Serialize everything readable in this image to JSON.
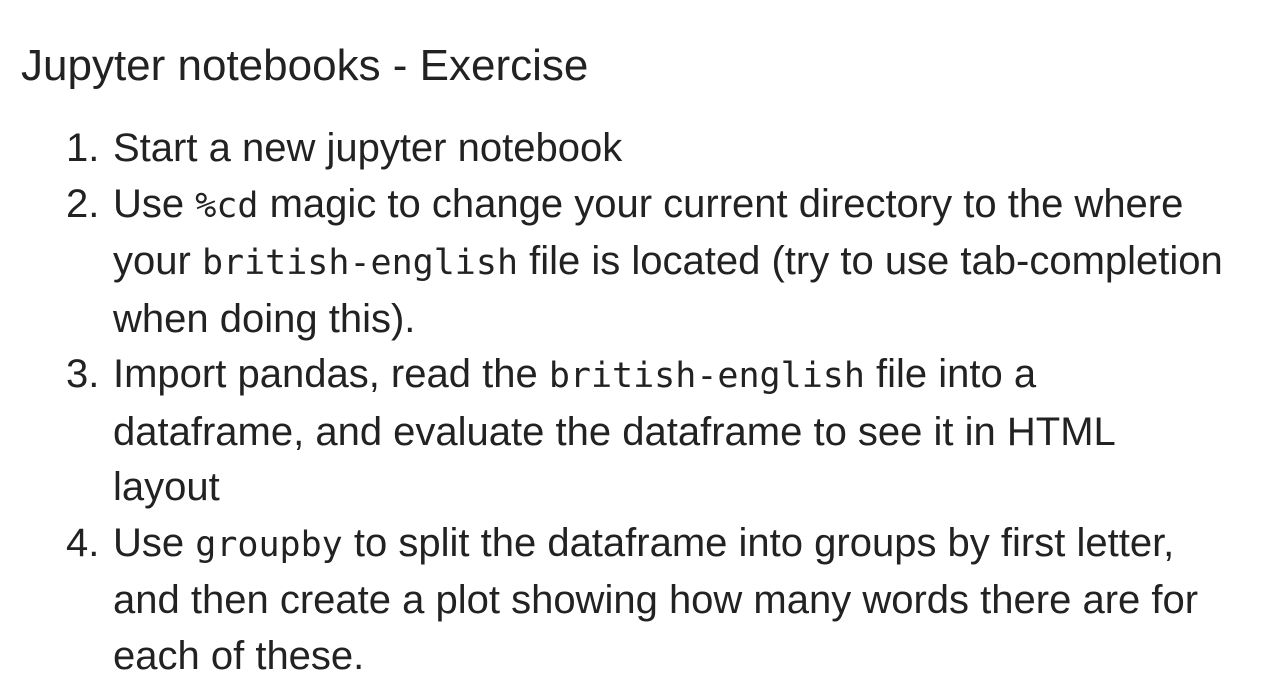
{
  "slide": {
    "title": "Jupyter notebooks - Exercise",
    "steps": [
      {
        "number": "1.",
        "parts": [
          {
            "text": "Start a new jupyter notebook",
            "code": false
          }
        ]
      },
      {
        "number": "2.",
        "parts": [
          {
            "text": "Use ",
            "code": false
          },
          {
            "text": "%cd",
            "code": true
          },
          {
            "text": " magic to change your current directory to the where your ",
            "code": false
          },
          {
            "text": "british-english",
            "code": true
          },
          {
            "text": " file is located (try to use tab-completion when doing this).",
            "code": false
          }
        ]
      },
      {
        "number": "3.",
        "parts": [
          {
            "text": "Import pandas, read the ",
            "code": false
          },
          {
            "text": "british-english",
            "code": true
          },
          {
            "text": " file into a dataframe, and evaluate the dataframe to see it in HTML layout",
            "code": false
          }
        ]
      },
      {
        "number": "4.",
        "parts": [
          {
            "text": "Use ",
            "code": false
          },
          {
            "text": "groupby",
            "code": true
          },
          {
            "text": " to split the dataframe into groups by first letter, and then create a plot showing how many words there are for each of these.",
            "code": false
          }
        ]
      }
    ]
  }
}
